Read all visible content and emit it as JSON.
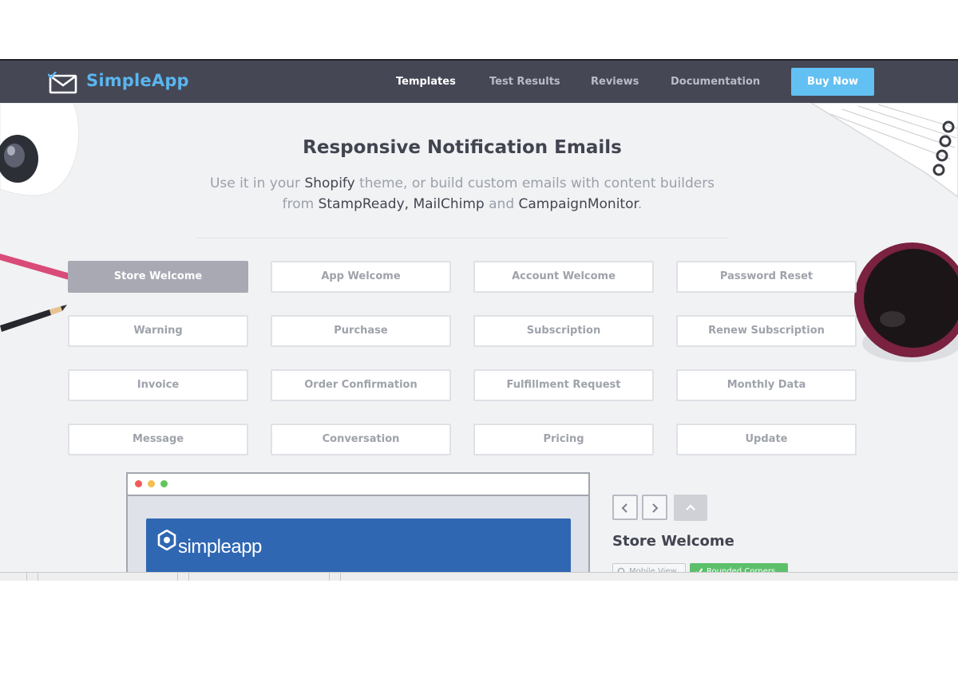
{
  "brand": {
    "name": "SimpleApp",
    "icon": "envelope-check-icon",
    "color": "#5ab5ee"
  },
  "nav": {
    "links": [
      {
        "label": "Templates",
        "active": true
      },
      {
        "label": "Test Results",
        "active": false
      },
      {
        "label": "Reviews",
        "active": false
      },
      {
        "label": "Documentation",
        "active": false
      }
    ],
    "cta": "Buy Now"
  },
  "hero": {
    "title": "Responsive Notification Emails",
    "line1": {
      "a": "Use it in your ",
      "b": "Shopify",
      "c": " theme, or build custom emails with content builders"
    },
    "line2": {
      "a": "from ",
      "b": "StampReady",
      "c": ", ",
      "d": "MailChimp",
      "e": " and ",
      "f": "CampaignMonitor",
      "g": "."
    }
  },
  "templates": [
    {
      "label": "Store Welcome",
      "active": true
    },
    {
      "label": "App Welcome",
      "active": false
    },
    {
      "label": "Account Welcome",
      "active": false
    },
    {
      "label": "Password Reset",
      "active": false
    },
    {
      "label": "Warning",
      "active": false
    },
    {
      "label": "Purchase",
      "active": false
    },
    {
      "label": "Subscription",
      "active": false
    },
    {
      "label": "Renew Subscription",
      "active": false
    },
    {
      "label": "Invoice",
      "active": false
    },
    {
      "label": "Order Confirmation",
      "active": false
    },
    {
      "label": "Fulfillment Request",
      "active": false
    },
    {
      "label": "Monthly Data",
      "active": false
    },
    {
      "label": "Message",
      "active": false
    },
    {
      "label": "Conversation",
      "active": false
    },
    {
      "label": "Pricing",
      "active": false
    },
    {
      "label": "Update",
      "active": false
    }
  ],
  "preview": {
    "window_dots": [
      "#f05c57",
      "#f5be4f",
      "#5fc65a"
    ],
    "email_logo": "simpleapp",
    "email_header_color": "#2f67b2"
  },
  "controls": {
    "prev_icon": "chevron-left-icon",
    "next_icon": "chevron-right-icon",
    "up_icon": "chevron-up-icon",
    "selected_title": "Store Welcome",
    "tags": [
      {
        "label": "Mobile View",
        "icon": "search-icon",
        "enabled": false
      },
      {
        "label": "Rounded Corners",
        "icon": "check-icon",
        "enabled": true
      }
    ]
  }
}
